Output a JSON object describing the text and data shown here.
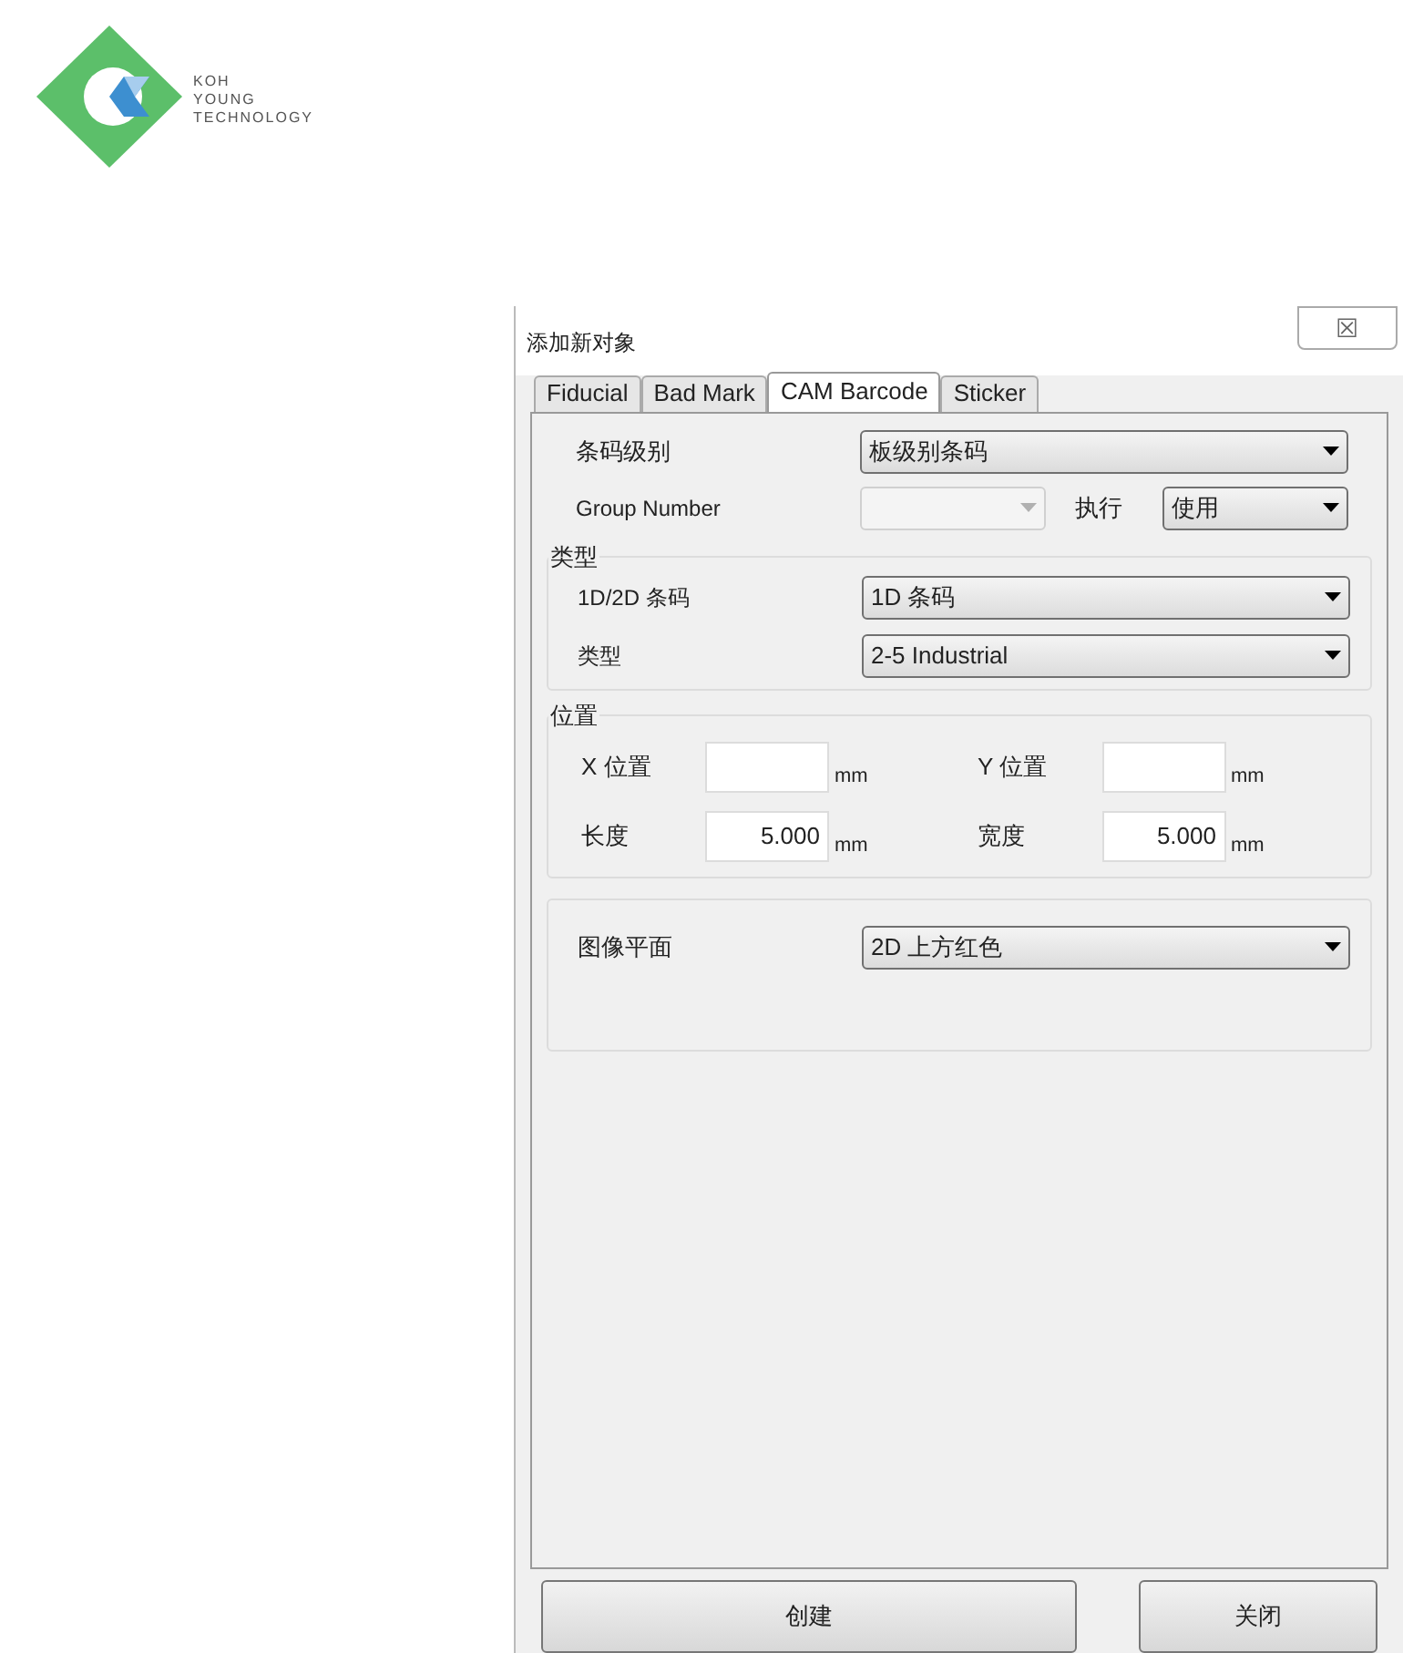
{
  "logo": {
    "lines": [
      "KOH",
      "YOUNG",
      "TECHNOLOGY"
    ]
  },
  "window": {
    "title": "添加新对象",
    "close": "☒"
  },
  "tabs": [
    {
      "label": "Fiducial",
      "selected": false
    },
    {
      "label": "Bad Mark",
      "selected": false
    },
    {
      "label": "CAM Barcode",
      "selected": true
    },
    {
      "label": "Sticker",
      "selected": false
    }
  ],
  "barcode_level": {
    "label": "条码级别",
    "value": "板级别条码"
  },
  "group_number": {
    "label": "Group Number",
    "disabled": true
  },
  "execute": {
    "label": "执行",
    "value": "使用"
  },
  "type_group": {
    "title": "类型",
    "rows": [
      {
        "label": "1D/2D 条码",
        "value": "1D 条码"
      },
      {
        "label": "类型",
        "value": "2-5 Industrial"
      }
    ]
  },
  "position_group": {
    "title": "位置",
    "fields": [
      {
        "label": "X 位置",
        "unit": "mm"
      },
      {
        "label": "Y 位置",
        "unit": "mm"
      },
      {
        "label": "长度",
        "value": "5.000",
        "unit": "mm"
      },
      {
        "label": "宽度",
        "value": "5.000",
        "unit": "mm"
      }
    ]
  },
  "image_plane": {
    "label": "图像平面",
    "value": "2D 上方红色"
  },
  "buttons": [
    "创建",
    "关闭"
  ]
}
